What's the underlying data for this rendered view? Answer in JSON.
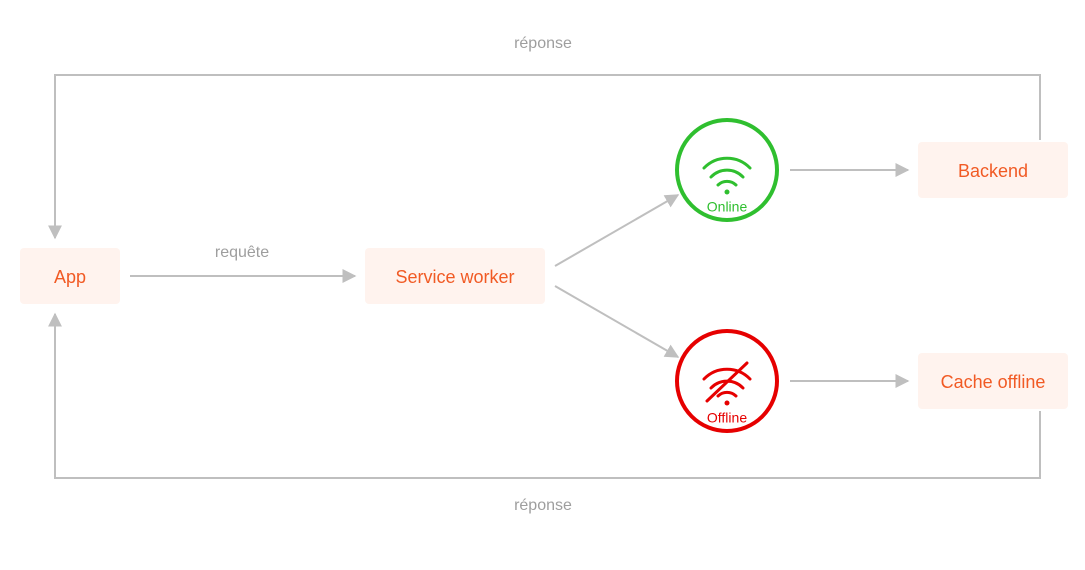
{
  "nodes": {
    "app": {
      "label": "App"
    },
    "serviceWorker": {
      "label": "Service worker"
    },
    "online": {
      "label": "Online"
    },
    "offline": {
      "label": "Offline"
    },
    "backend": {
      "label": "Backend"
    },
    "cacheOffline": {
      "label": "Cache offline"
    }
  },
  "edges": {
    "appToSw": {
      "label": "requête"
    },
    "topReturn": {
      "label": "réponse"
    },
    "bottomReturn": {
      "label": "réponse"
    }
  },
  "colors": {
    "nodeFill": "#fff3ee",
    "nodeText": "#f15a24",
    "arrow": "#bfbfbf",
    "label": "#9e9e9e",
    "online": "#2fbf2f",
    "offline": "#e60000"
  }
}
